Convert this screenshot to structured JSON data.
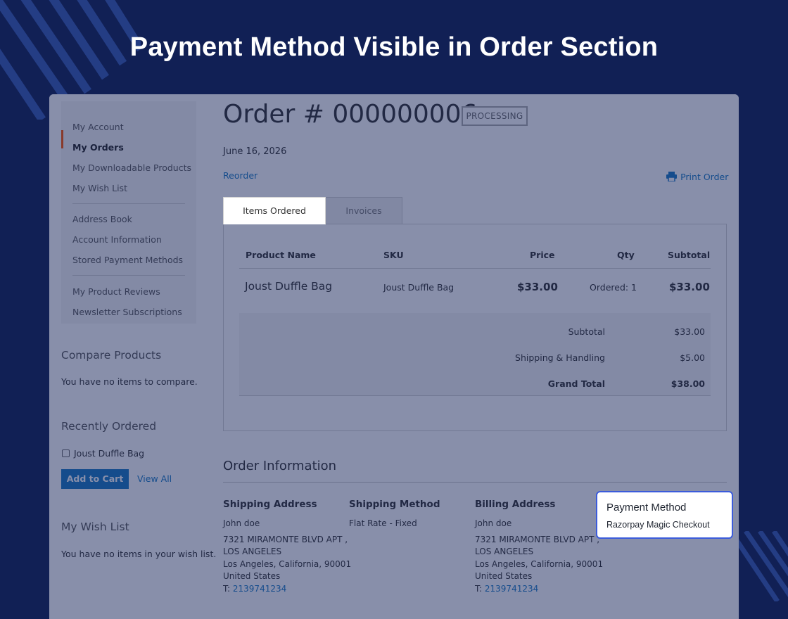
{
  "headline": "Payment Method Visible in Order Section",
  "colors": {
    "background": "#112055",
    "accent": "#1979c3",
    "active_nav": "#ff5501",
    "highlight_border": "#3b5bdb"
  },
  "sidebar": {
    "items": [
      {
        "label": "My Account",
        "active": false
      },
      {
        "label": "My Orders",
        "active": true
      },
      {
        "label": "My Downloadable Products",
        "active": false
      },
      {
        "label": "My Wish List",
        "active": false
      },
      {
        "label": "Address Book",
        "active": false
      },
      {
        "label": "Account Information",
        "active": false
      },
      {
        "label": "Stored Payment Methods",
        "active": false
      },
      {
        "label": "My Product Reviews",
        "active": false
      },
      {
        "label": "Newsletter Subscriptions",
        "active": false
      }
    ],
    "compare": {
      "title": "Compare Products",
      "text": "You have no items to compare."
    },
    "recent": {
      "title": "Recently Ordered",
      "item": "Joust Duffle Bag",
      "add_to_cart": "Add to Cart",
      "view_all": "View All"
    },
    "wishlist": {
      "title": "My Wish List",
      "text": "You have no items in your wish list."
    }
  },
  "order": {
    "title": "Order # 000000006",
    "status": "PROCESSING",
    "date": "June 16, 2026",
    "reorder": "Reorder",
    "print": "Print Order",
    "tabs": [
      {
        "label": "Items Ordered"
      },
      {
        "label": "Invoices"
      }
    ],
    "columns": {
      "name": "Product Name",
      "sku": "SKU",
      "price": "Price",
      "qty": "Qty",
      "subtotal": "Subtotal"
    },
    "item": {
      "name": "Joust Duffle Bag",
      "sku": "Joust Duffle Bag",
      "price": "$33.00",
      "qty": "Ordered: 1",
      "subtotal": "$33.00"
    },
    "totals": {
      "subtotal_label": "Subtotal",
      "subtotal": "$33.00",
      "shipping_label": "Shipping & Handling",
      "shipping": "$5.00",
      "grand_label": "Grand Total",
      "grand": "$38.00"
    }
  },
  "info": {
    "title": "Order Information",
    "shipping_address": {
      "title": "Shipping Address",
      "name": "John doe",
      "street1": "7321 MIRAMONTE BLVD APT ,",
      "street2": "LOS ANGELES",
      "city": "Los Angeles, California, 90001",
      "country": "United States",
      "phone_prefix": "T:",
      "phone": "2139741234"
    },
    "shipping_method": {
      "title": "Shipping Method",
      "value": "Flat Rate - Fixed"
    },
    "billing_address": {
      "title": "Billing Address",
      "name": "John doe",
      "street1": "7321 MIRAMONTE BLVD APT ,",
      "street2": "LOS ANGELES",
      "city": "Los Angeles, California, 90001",
      "country": "United States",
      "phone_prefix": "T:",
      "phone": "2139741234"
    },
    "payment_method": {
      "title": "Payment Method",
      "value": "Razorpay Magic Checkout"
    }
  }
}
